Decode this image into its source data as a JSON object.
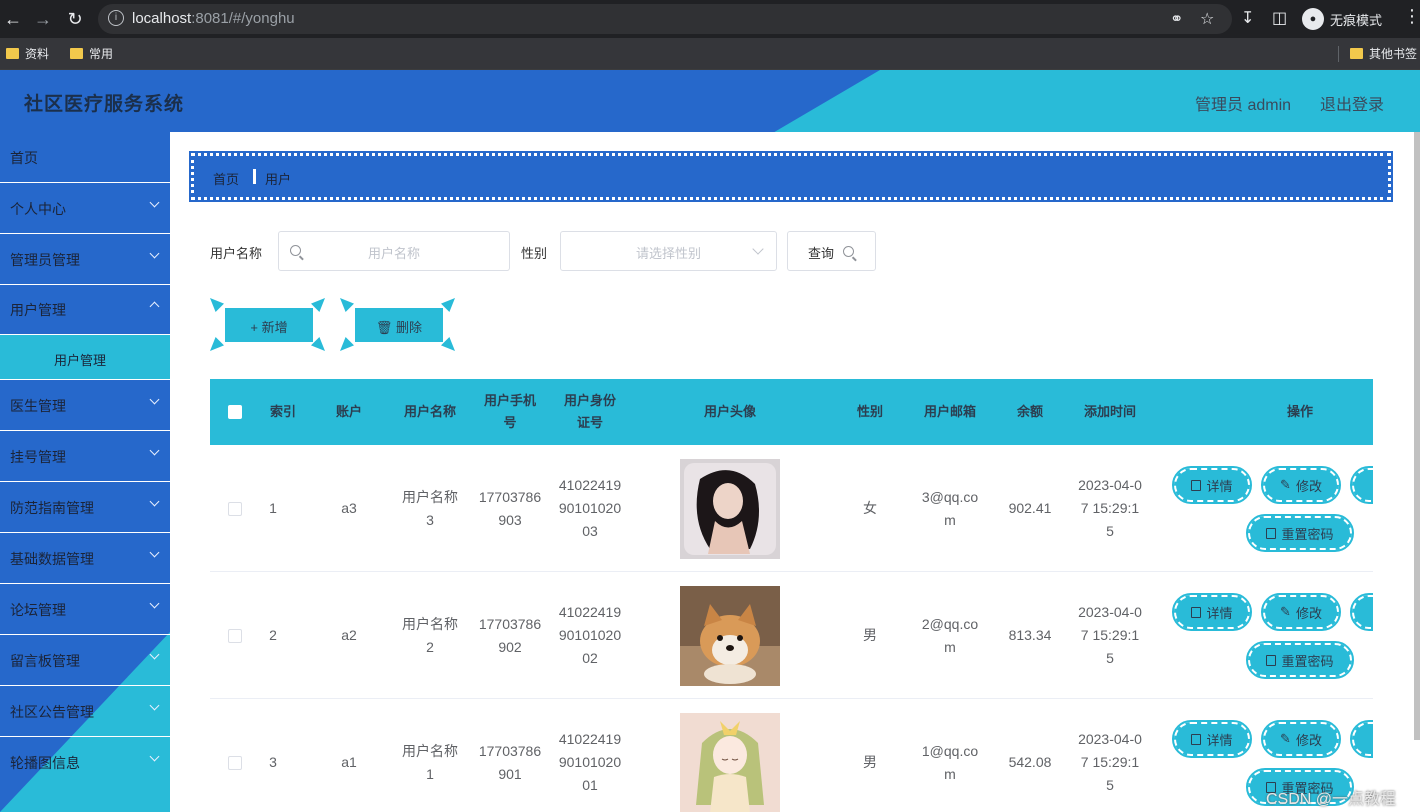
{
  "browser": {
    "url_host": "localhost",
    "url_rest": ":8081/#/yonghu",
    "incognito_label": "无痕模式",
    "bookmarks": [
      "资料",
      "常用"
    ],
    "other_bookmarks": "其他书签"
  },
  "header": {
    "title": "社区医疗服务系统",
    "admin": "管理员 admin",
    "logout": "退出登录",
    "colors": {
      "primary": "#2668cb",
      "accent": "#29bbd8"
    }
  },
  "sidebar": {
    "items": [
      {
        "label": "首页",
        "chevron": false
      },
      {
        "label": "个人中心",
        "chevron": true
      },
      {
        "label": "管理员管理",
        "chevron": true
      },
      {
        "label": "用户管理",
        "chevron": true,
        "open": true
      },
      {
        "label": "医生管理",
        "chevron": true
      },
      {
        "label": "挂号管理",
        "chevron": true
      },
      {
        "label": "防范指南管理",
        "chevron": true
      },
      {
        "label": "基础数据管理",
        "chevron": true
      },
      {
        "label": "论坛管理",
        "chevron": true
      },
      {
        "label": "留言板管理",
        "chevron": true
      },
      {
        "label": "社区公告管理",
        "chevron": true
      },
      {
        "label": "轮播图信息",
        "chevron": true
      }
    ],
    "sub_item": "用户管理"
  },
  "breadcrumb": {
    "home": "首页",
    "current": "用户"
  },
  "search": {
    "name_label": "用户名称",
    "name_placeholder": "用户名称",
    "gender_label": "性别",
    "gender_placeholder": "请选择性别",
    "query_button": "查询"
  },
  "actions": {
    "add": "新增",
    "delete": "删除"
  },
  "table": {
    "columns": [
      "索引",
      "账户",
      "用户名称",
      "用户手机号",
      "用户身份证号",
      "用户头像",
      "性别",
      "用户邮箱",
      "余额",
      "添加时间",
      "操作"
    ],
    "rows": [
      {
        "index": "1",
        "account": "a3",
        "name": "用户名称3",
        "phone": "17703786903",
        "idcard": "410224199010102003",
        "avatar": "woman-portrait-photo",
        "gender": "女",
        "email": "3@qq.com",
        "balance": "902.41",
        "time": "2023-04-07 15:29:15"
      },
      {
        "index": "2",
        "account": "a2",
        "name": "用户名称2",
        "phone": "17703786902",
        "idcard": "410224199010102002",
        "avatar": "shiba-dog-photo",
        "gender": "男",
        "email": "2@qq.com",
        "balance": "813.34",
        "time": "2023-04-07 15:29:15"
      },
      {
        "index": "3",
        "account": "a1",
        "name": "用户名称1",
        "phone": "17703786901",
        "idcard": "410224199010102001",
        "avatar": "anime-girl-illustration",
        "gender": "男",
        "email": "1@qq.com",
        "balance": "542.08",
        "time": "2023-04-07 15:29:15"
      }
    ],
    "ops": {
      "detail": "详情",
      "edit": "修改",
      "reset_password": "重置密码"
    }
  },
  "watermark": "CSDN @一点教程"
}
